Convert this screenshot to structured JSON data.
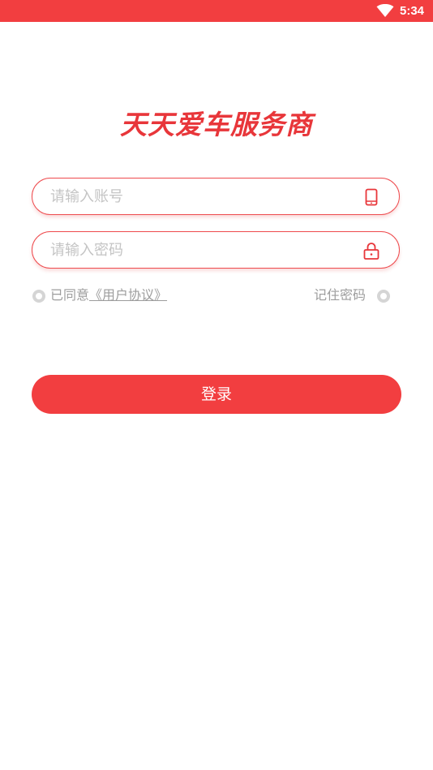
{
  "status_bar": {
    "time": "5:34",
    "color": "#f23e40",
    "wifi_icon": "wifi-icon"
  },
  "app": {
    "title": "天天爱车服务商",
    "accent_color": "#f23e40"
  },
  "form": {
    "account": {
      "placeholder": "请输入账号",
      "value": "",
      "icon": "phone-icon"
    },
    "password": {
      "placeholder": "请输入密码",
      "value": "",
      "icon": "lock-icon"
    },
    "agree_prefix": "已同意",
    "agreement_link": "《用户协议》",
    "agree_checked": false,
    "remember_label": "记住密码",
    "remember_checked": false,
    "login_label": "登录"
  }
}
